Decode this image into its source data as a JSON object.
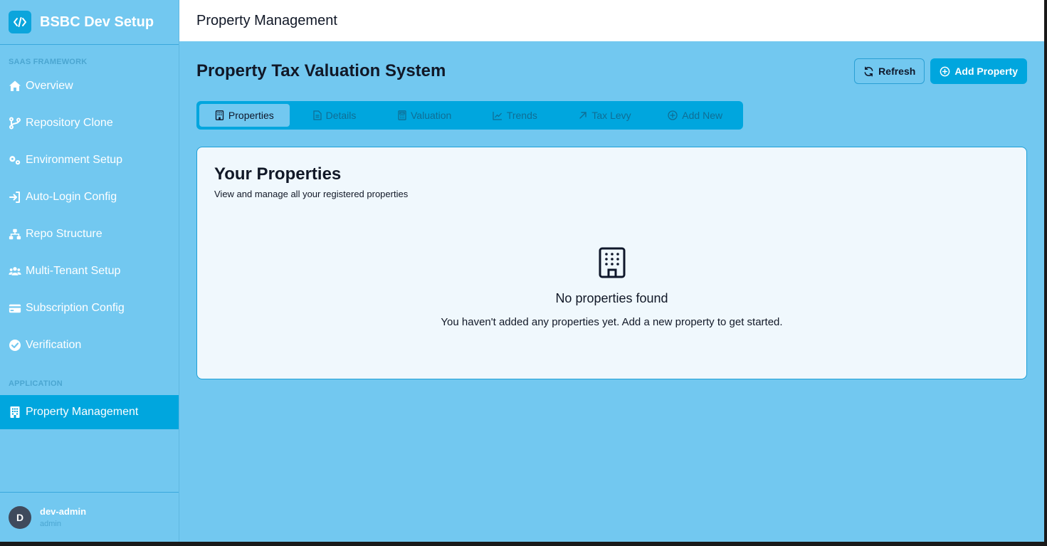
{
  "brand": {
    "title": "BSBC Dev Setup",
    "logo_icon": "code-icon"
  },
  "sidebar": {
    "section_framework": "SAAS FRAMEWORK",
    "section_application": "APPLICATION",
    "items": [
      {
        "label": "Overview",
        "icon": "home-icon"
      },
      {
        "label": "Repository Clone",
        "icon": "git-branch-icon"
      },
      {
        "label": "Environment Setup",
        "icon": "gears-icon"
      },
      {
        "label": "Auto-Login Config",
        "icon": "sign-in-icon"
      },
      {
        "label": "Repo Structure",
        "icon": "sitemap-icon"
      },
      {
        "label": "Multi-Tenant Setup",
        "icon": "users-icon"
      },
      {
        "label": "Subscription Config",
        "icon": "credit-card-icon"
      },
      {
        "label": "Verification",
        "icon": "check-circle-icon"
      }
    ],
    "app_items": [
      {
        "label": "Property Management",
        "icon": "building-icon",
        "active": true
      }
    ]
  },
  "user": {
    "initial": "D",
    "name": "dev-admin",
    "role": "admin"
  },
  "topbar": {
    "title": "Property Management"
  },
  "page": {
    "title": "Property Tax Valuation System",
    "refresh_label": "Refresh",
    "add_label": "Add Property"
  },
  "tabs": [
    {
      "label": "Properties",
      "icon": "building-icon",
      "active": true
    },
    {
      "label": "Details",
      "icon": "document-icon"
    },
    {
      "label": "Valuation",
      "icon": "calculator-icon"
    },
    {
      "label": "Trends",
      "icon": "line-chart-icon"
    },
    {
      "label": "Tax Levy",
      "icon": "arrow-up-right-icon"
    },
    {
      "label": "Add New",
      "icon": "plus-circle-icon"
    }
  ],
  "card": {
    "title": "Your Properties",
    "subtitle": "View and manage all your registered properties",
    "empty_title": "No properties found",
    "empty_desc": "You haven't added any properties yet. Add a new property to get started."
  },
  "colors": {
    "background": "#72c8f0",
    "accent": "#00a6de",
    "card_bg": "#f0f8fd",
    "topbar_bg": "#ffffff"
  }
}
